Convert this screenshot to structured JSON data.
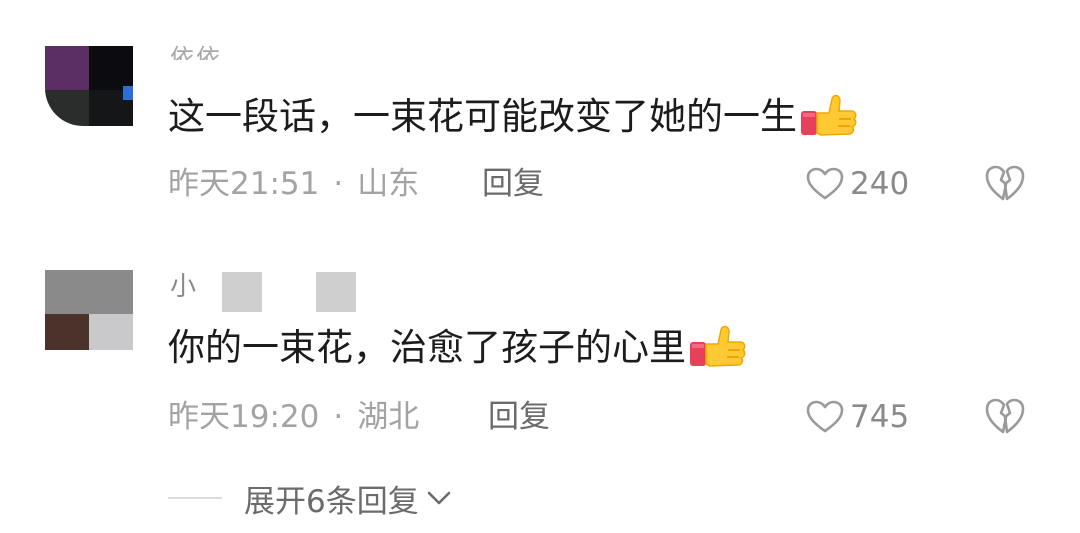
{
  "comments": [
    {
      "username": "依依",
      "text": "这一段话，一束花可能改变了她的一生",
      "time": "昨天21:51",
      "separator": "·",
      "location": "山东",
      "reply_label": "回复",
      "likes": "240",
      "emoji_icon": "thumbs-up-icon"
    },
    {
      "username": "小",
      "text": "你的一束花，治愈了孩子的心里",
      "time": "昨天19:20",
      "separator": "·",
      "location": "湖北",
      "reply_label": "回复",
      "likes": "745",
      "emoji_icon": "thumbs-up-icon"
    }
  ],
  "expand_replies": {
    "label": "展开6条回复",
    "icon": "chevron-down-icon"
  },
  "colors": {
    "meta_text": "#a3a3a3",
    "action_text": "#6b6b6b",
    "body_text": "#1c1c1c"
  }
}
